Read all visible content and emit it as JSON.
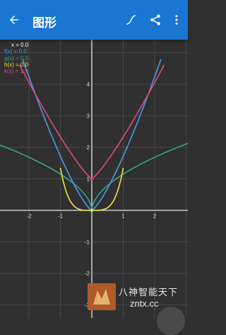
{
  "appbar": {
    "title": "图形",
    "back_icon": "arrow-back-icon",
    "trace_icon": "trace-curve-icon",
    "share_icon": "share-icon",
    "menu_icon": "more-vert-icon",
    "color": "#1976D2"
  },
  "legend": {
    "x": "x = 0.0",
    "f": "f(x) = 0.0",
    "g": "g(x) = 0.0",
    "h": "h(x) = 0.0",
    "k": "k(x) = 1.0"
  },
  "colors": {
    "x": "#ffffff",
    "f": "#4a9be6",
    "g": "#2fa58f",
    "h": "#f4e33d",
    "k": "#e0487a"
  },
  "axis": {
    "x_ticks": [
      "-2",
      "-1",
      "1",
      "2"
    ],
    "y_ticks": [
      "4",
      "3",
      "2",
      "1",
      "-1",
      "-2",
      "-3"
    ]
  },
  "watermark": {
    "line1": "八神智能天下",
    "line2": "zntx.cc"
  }
}
